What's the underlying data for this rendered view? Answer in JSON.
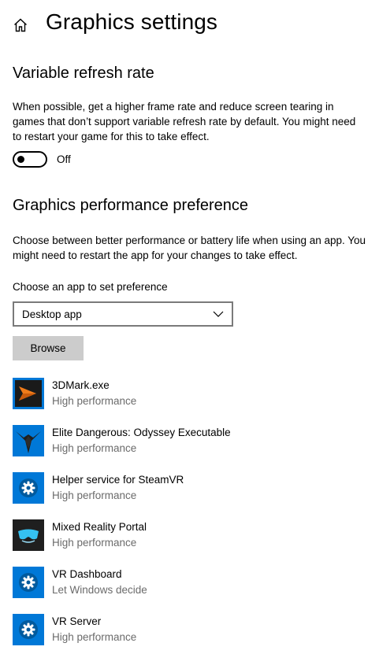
{
  "header": {
    "title": "Graphics settings",
    "home_icon": "home-icon"
  },
  "vrr": {
    "title": "Variable refresh rate",
    "description": "When possible, get a higher frame rate and reduce screen tearing in games that don’t support variable refresh rate by default. You might need to restart your game for this to take effect.",
    "toggle_state": "Off"
  },
  "gpp": {
    "title": "Graphics performance preference",
    "description": "Choose between better performance or battery life when using an app. You might need to restart the app for your changes to take effect.",
    "select_label": "Choose an app to set preference",
    "select_value": "Desktop app",
    "browse_label": "Browse"
  },
  "apps": [
    {
      "name": "3DMark.exe",
      "preference": "High performance",
      "icon": "3dmark-icon"
    },
    {
      "name": "Elite Dangerous: Odyssey Executable",
      "preference": "High performance",
      "icon": "elite-dangerous-icon"
    },
    {
      "name": "Helper service for SteamVR",
      "preference": "High performance",
      "icon": "gear-icon"
    },
    {
      "name": "Mixed Reality Portal",
      "preference": "High performance",
      "icon": "mixed-reality-icon"
    },
    {
      "name": "VR Dashboard",
      "preference": "Let Windows decide",
      "icon": "gear-icon"
    },
    {
      "name": "VR Server",
      "preference": "High performance",
      "icon": "gear-icon"
    }
  ],
  "colors": {
    "accent_blue": "#0078d7",
    "secondary_text": "#6b6b6b",
    "button_gray": "#cccccc",
    "select_border": "#7a7a7a"
  }
}
